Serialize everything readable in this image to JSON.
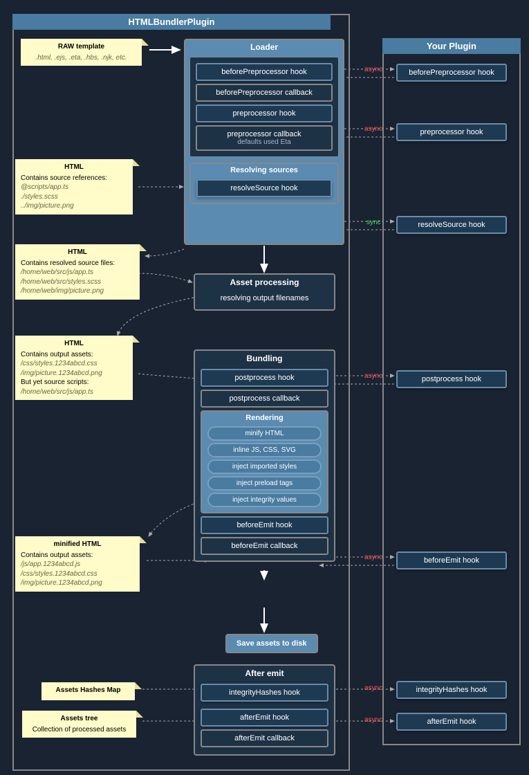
{
  "main_title": "HTMLBundlerPlugin",
  "plugin_title": "Your Plugin",
  "notes": {
    "raw": {
      "title": "RAW template",
      "line1": ".html, .ejs, .eta, .hbs, .njk, etc."
    },
    "html1": {
      "title": "HTML",
      "line1": "Contains source references:",
      "line2": "@scripts/app.ts",
      "line3": "./styles.scss",
      "line4": "../img/picture.png"
    },
    "html2": {
      "title": "HTML",
      "line1": "Contains resolved source files:",
      "line2": "/home/web/src/js/app.ts",
      "line3": "/home/web/src/styles.scss",
      "line4": "/home/web/img/picture.png"
    },
    "html3": {
      "title": "HTML",
      "line1": "Contains output assets:",
      "line2": "/css/styles.1234abcd.css",
      "line3": "/img/picture.1234abcd.png",
      "line4": "But yet source scripts:",
      "line5": "/home/web/src/js/app.ts"
    },
    "html4": {
      "title": "minified HTML",
      "line1": "Contains output assets:",
      "line2": "/js/app.1234abcd.js",
      "line3": "/css/styles.1234abcd.css",
      "line4": "/img/picture.1234abcd.png"
    },
    "hashes": {
      "title": "Assets Hashes Map"
    },
    "tree": {
      "title": "Assets tree",
      "line1": "Collection of processed assets"
    }
  },
  "loader": {
    "title": "Loader",
    "before_pre_hook": "beforePreprocessor hook",
    "before_pre_cb": "beforePreprocessor callback",
    "pre_hook": "preprocessor hook",
    "pre_cb": "preprocessor callback",
    "pre_cb_sub": "defaults used Eta",
    "resolving_title": "Resolving sources",
    "resolve_hook": "resolveSource hook"
  },
  "asset": {
    "title": "Asset processing",
    "line1": "resolving output filenames"
  },
  "bundling": {
    "title": "Bundling",
    "postprocess_hook": "postprocess hook",
    "postprocess_cb": "postprocess callback",
    "rendering_title": "Rendering",
    "pills": [
      "minify HTML",
      "inline JS, CSS, SVG",
      "inject imported styles",
      "inject preload tags",
      "inject integrity values"
    ],
    "beforeemit_hook": "beforeEmit hook",
    "beforeemit_cb": "beforeEmit callback"
  },
  "save": "Save assets to disk",
  "afteremit": {
    "title": "After emit",
    "integrity_hook": "integrityHashes hook",
    "afteremit_hook": "afterEmit hook",
    "afteremit_cb": "afterEmit callback"
  },
  "plugin_hooks": {
    "before_pre": "beforePreprocessor hook",
    "pre": "preprocessor hook",
    "resolve": "resolveSource hook",
    "postprocess": "postprocess hook",
    "beforeemit": "beforeEmit hook",
    "integrity": "integrityHashes hook",
    "afteremit": "afterEmit hook"
  },
  "labels": {
    "async": "async",
    "sync": "sync"
  }
}
